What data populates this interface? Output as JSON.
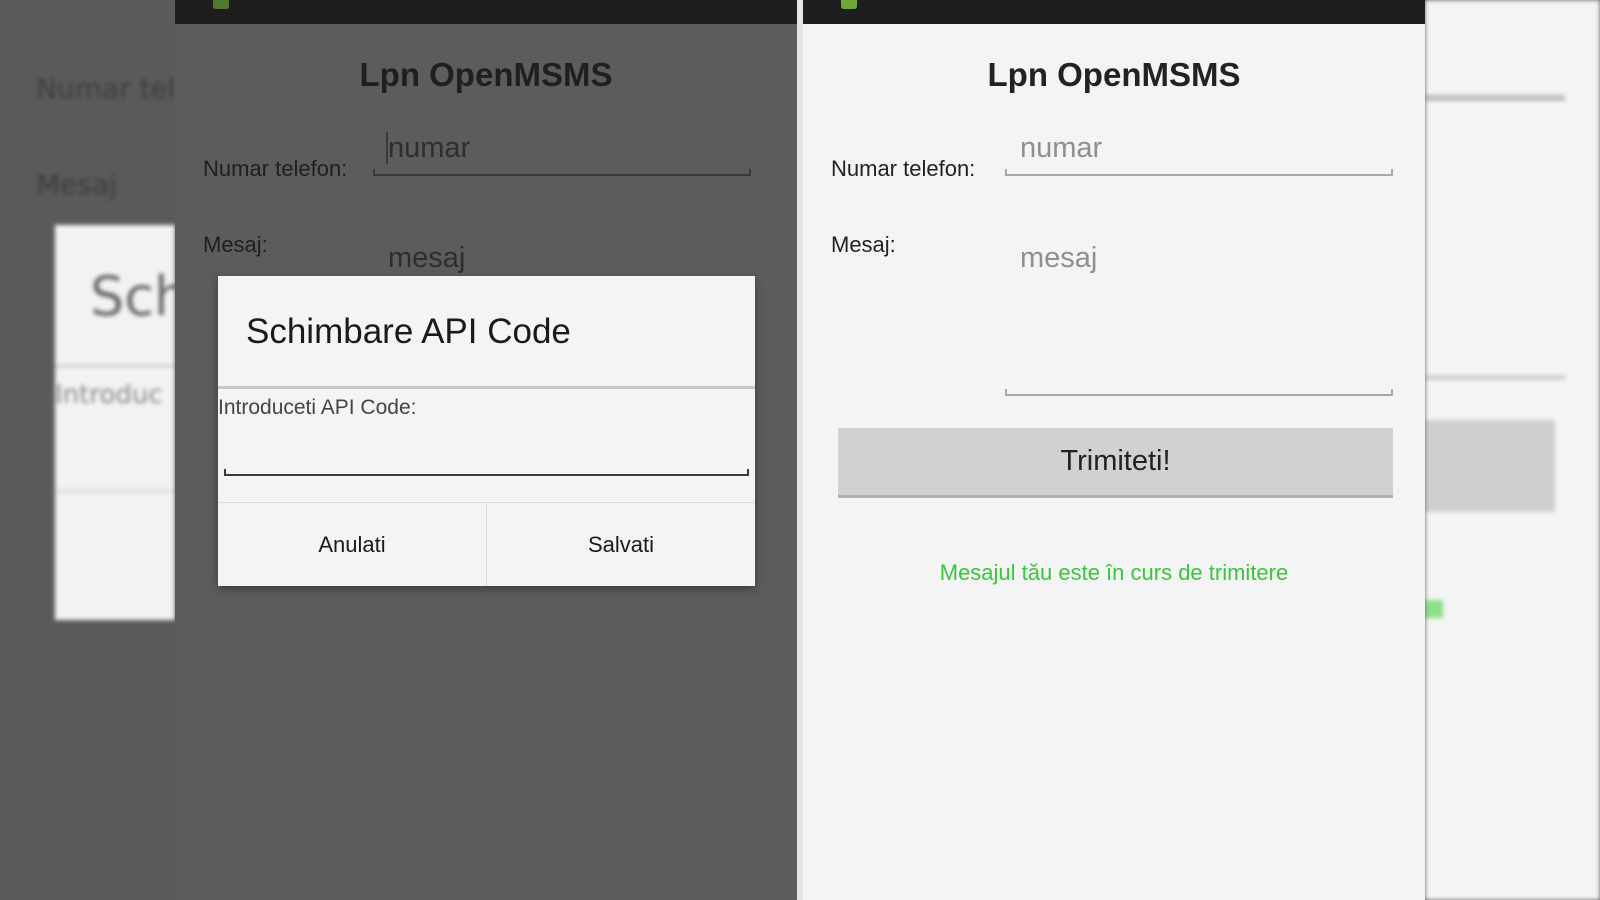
{
  "background_left": {
    "label_phone": "Numar tel",
    "label_message": "Mesaj",
    "dialog_title": "Schi",
    "dialog_hint": "Introduc"
  },
  "app": {
    "title": "Lpn OpenMSMS",
    "phone_label": "Numar telefon:",
    "phone_placeholder": "numar",
    "message_label": "Mesaj:",
    "message_placeholder": "mesaj",
    "send_button": "Trimiteti!",
    "status_message": "Mesajul tău este în curs de trimitere",
    "status_color": "#38c63c"
  },
  "dialog": {
    "title": "Schimbare API Code",
    "hint": "Introduceti API Code:",
    "cancel_button": "Anulati",
    "save_button": "Salvati"
  },
  "icons": {
    "status_bar": "android-icon"
  }
}
